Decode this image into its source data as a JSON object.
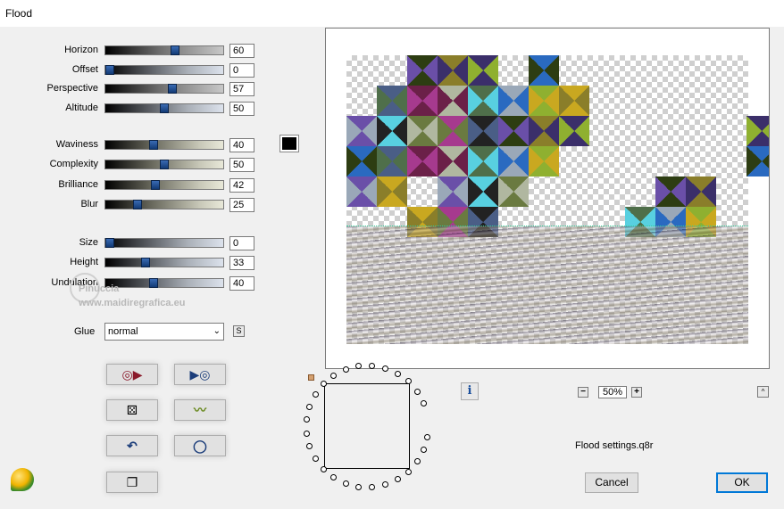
{
  "window": {
    "title": "Flood"
  },
  "params": [
    {
      "id": "horizon",
      "label": "Horizon",
      "value": "60",
      "pct": 60
    },
    {
      "id": "offset",
      "label": "Offset",
      "value": "0",
      "pct": 0
    },
    {
      "id": "perspective",
      "label": "Perspective",
      "value": "57",
      "pct": 57
    },
    {
      "id": "altitude",
      "label": "Altitude",
      "value": "50",
      "pct": 50
    },
    {
      "id": "waviness",
      "label": "Waviness",
      "value": "40",
      "pct": 40
    },
    {
      "id": "complexity",
      "label": "Complexity",
      "value": "50",
      "pct": 50
    },
    {
      "id": "brilliance",
      "label": "Brilliance",
      "value": "42",
      "pct": 42
    },
    {
      "id": "blur",
      "label": "Blur",
      "value": "25",
      "pct": 25
    },
    {
      "id": "size",
      "label": "Size",
      "value": "0",
      "pct": 0
    },
    {
      "id": "height",
      "label": "Height",
      "value": "33",
      "pct": 33
    },
    {
      "id": "undulation",
      "label": "Undulation",
      "value": "40",
      "pct": 40
    }
  ],
  "color": "#000000",
  "watermark": {
    "line1": "Pinuccia",
    "line2": "www.maidiregrafica.eu"
  },
  "glue": {
    "label": "Glue",
    "value": "normal",
    "s_label": "S"
  },
  "preview": {
    "zoom": "50%",
    "zoom_minus": "−",
    "zoom_plus": "+",
    "up": "^"
  },
  "info_label": "i",
  "settings_file": "Flood settings.q8r",
  "buttons": {
    "cancel": "Cancel",
    "ok": "OK"
  },
  "icons": {
    "prev_preset": "◎▶",
    "next_preset": "▶◎",
    "random": "⚄",
    "wave": "〰",
    "undo": "↶",
    "reset": "◯",
    "copy": "❐"
  }
}
